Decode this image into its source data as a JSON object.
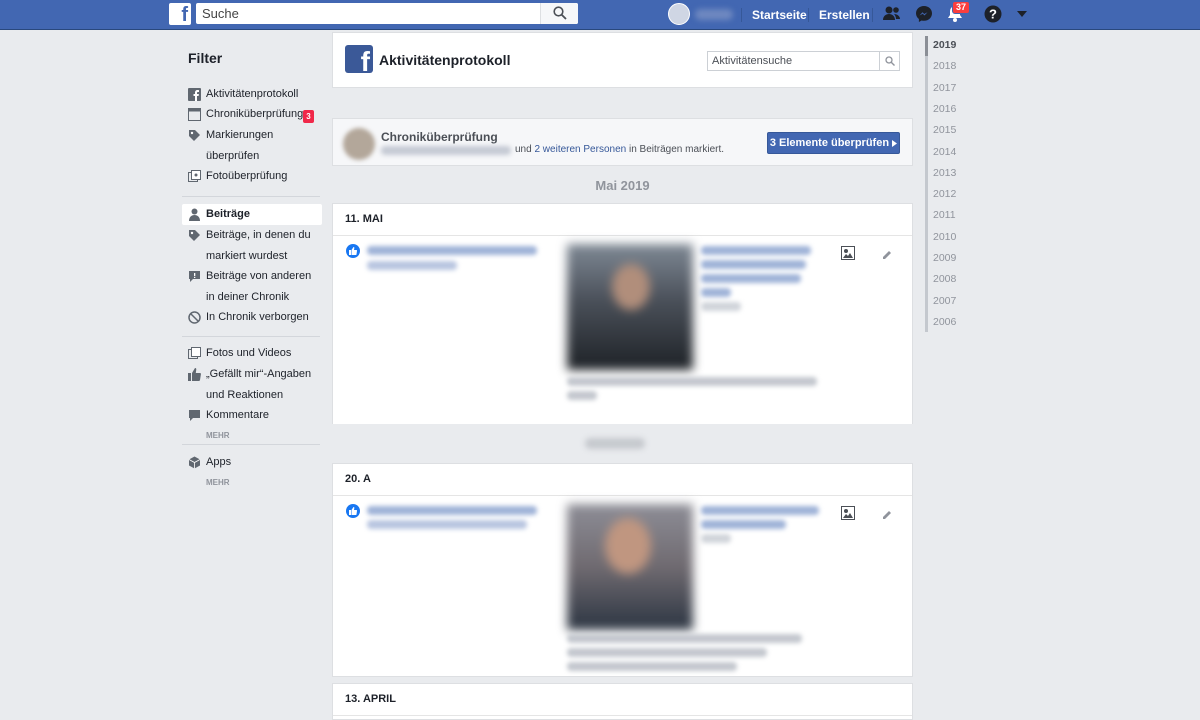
{
  "topbar": {
    "logo": "f",
    "search_placeholder": "Suche",
    "nav": [
      "Startseite",
      "Erstellen"
    ],
    "notifications_count": "37",
    "icons": [
      "friends-icon",
      "messenger-icon",
      "bell-icon",
      "help-icon",
      "caret-down-icon"
    ]
  },
  "sidebar": {
    "title": "Filter",
    "review_badge": "3",
    "items": [
      {
        "label": "Aktivitätenprotokoll",
        "icon": "fb-square-icon"
      },
      {
        "label": "Chroniküberprüfung",
        "icon": "timeline-icon"
      },
      {
        "label": "Markierungen",
        "icon": "tag-icon"
      },
      {
        "label": "überprüfen"
      },
      {
        "label": "Fotoüberprüfung",
        "icon": "photo-review-icon"
      },
      {
        "label": "Beiträge",
        "icon": "person-icon"
      },
      {
        "label": "Beiträge, in denen du",
        "icon": "tag-icon"
      },
      {
        "label": "markiert wurdest"
      },
      {
        "label": "Beiträge von anderen",
        "icon": "comment-icon"
      },
      {
        "label": "in deiner Chronik"
      },
      {
        "label": "In Chronik verborgen",
        "icon": "hidden-icon"
      },
      {
        "label": "Fotos und Videos",
        "icon": "photos-icon"
      },
      {
        "label": "„Gefällt mir“-Angaben",
        "icon": "thumbs-up-icon"
      },
      {
        "label": "und Reaktionen"
      },
      {
        "label": "Kommentare",
        "icon": "comment-icon"
      },
      {
        "label": "Apps",
        "icon": "cube-icon"
      }
    ],
    "more": "MEHR"
  },
  "header": {
    "title": "Aktivitätenprotokoll",
    "search_placeholder": "Aktivitätensuche"
  },
  "review": {
    "title": "Chroniküberprüfung",
    "text_prefix": "und ",
    "text_link": "2 weiteren Personen",
    "text_suffix": " in Beiträgen markiert.",
    "button": "3 Elemente überprüfen"
  },
  "month": "Mai 2019",
  "dates": [
    "11. MAI",
    "20. A",
    "13. APRIL"
  ],
  "years": [
    "2019",
    "2018",
    "2017",
    "2016",
    "2015",
    "2014",
    "2013",
    "2012",
    "2011",
    "2010",
    "2009",
    "2008",
    "2007",
    "2006"
  ],
  "colors": {
    "brand": "#4267b2",
    "like": "#1877f2",
    "badge": "#fa3e3e"
  }
}
